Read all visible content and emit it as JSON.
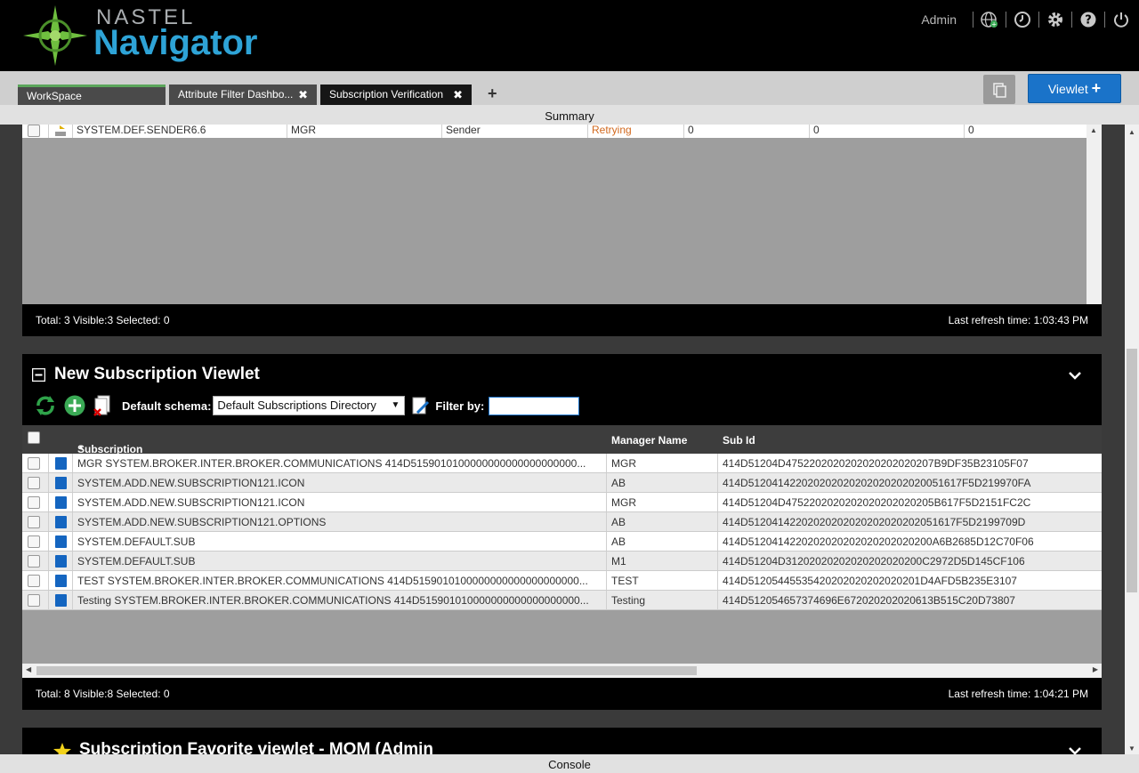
{
  "app": {
    "brand_top": "NASTEL",
    "brand_main": "Navigator"
  },
  "header": {
    "user": "Admin",
    "icons": [
      "globe-icon",
      "clock-icon",
      "gear-icon",
      "help-icon",
      "power-icon"
    ]
  },
  "tabs": [
    {
      "label": "WorkSpace",
      "closable": false
    },
    {
      "label": "Attribute Filter Dashbo...",
      "closable": true
    },
    {
      "label": "Subscription Verification",
      "closable": true,
      "active": true
    }
  ],
  "tab_close": "✖",
  "tab_add": "+",
  "viewlet_button": "Viewlet",
  "summary": "Summary",
  "console": "Console",
  "panel1": {
    "row": {
      "name": "SYSTEM.DEF.SENDER6.6",
      "manager": "MGR",
      "type": "Sender",
      "status": "Retrying",
      "c1": "0",
      "c2": "0",
      "c3": "0"
    },
    "status_left": "Total: 3 Visible:3 Selected: 0",
    "status_right": "Last refresh time: 1:03:43 PM"
  },
  "panel2": {
    "title": "New Subscription Viewlet",
    "default_schema_label": "Default schema:",
    "default_schema_value": "Default Subscriptions Directory",
    "filter_label": "Filter by:",
    "filter_value": "",
    "columns": {
      "name": "Subscription Name",
      "manager": "Manager Name",
      "subid": "Sub Id"
    },
    "rows": [
      {
        "name": "MGR SYSTEM.BROKER.INTER.BROKER.COMMUNICATIONS 414D5159010100000000000000000000...",
        "manager": "MGR",
        "subid": "414D51204D4752202020202020202020207B9DF35B23105F07"
      },
      {
        "name": "SYSTEM.ADD.NEW.SUBSCRIPTION121.ICON",
        "manager": "AB",
        "subid": "414D512041422020202020202020202020051617F5D219970FA"
      },
      {
        "name": "SYSTEM.ADD.NEW.SUBSCRIPTION121.ICON",
        "manager": "MGR",
        "subid": "414D51204D4752202020202020202020205B617F5D2151FC2C"
      },
      {
        "name": "SYSTEM.ADD.NEW.SUBSCRIPTION121.OPTIONS",
        "manager": "AB",
        "subid": "414D51204142202020202020202020202051617F5D2199709D"
      },
      {
        "name": "SYSTEM.DEFAULT.SUB",
        "manager": "AB",
        "subid": "414D5120414220202020202020202020200A6B2685D12C70F06"
      },
      {
        "name": "SYSTEM.DEFAULT.SUB",
        "manager": "M1",
        "subid": "414D51204D31202020202020202020200C2972D5D145CF106"
      },
      {
        "name": "TEST SYSTEM.BROKER.INTER.BROKER.COMMUNICATIONS 414D5159010100000000000000000000...",
        "manager": "TEST",
        "subid": "414D51205445535420202020202020201D4AFD5B235E3107"
      },
      {
        "name": "Testing SYSTEM.BROKER.INTER.BROKER.COMMUNICATIONS 414D515901010000000000000000000...",
        "manager": "Testing",
        "subid": "414D512054657374696E672020202020613B515C20D73807"
      }
    ],
    "status_left": "Total: 8 Visible:8 Selected: 0",
    "status_right": "Last refresh time: 1:04:21 PM"
  },
  "panel3": {
    "title": "Subscription Favorite viewlet - MOM (Admin"
  },
  "colors": {
    "accent": "#1a73c9",
    "retrying": "#d2691e",
    "brand": "#2ea3d6",
    "refresh": "#2fa34a",
    "add": "#3aaa55"
  }
}
